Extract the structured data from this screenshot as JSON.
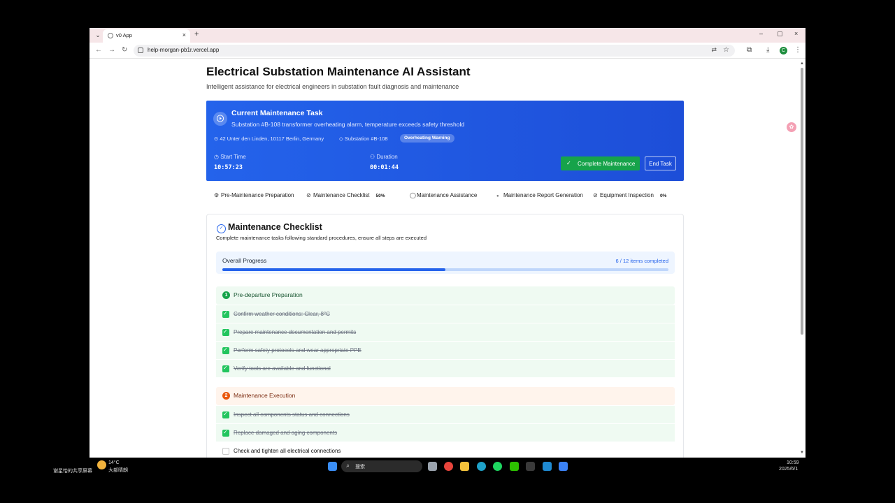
{
  "browser": {
    "tab_title": "v0 App",
    "url": "help-morgan-pb1r.vercel.app",
    "new_tab_symbol": "+",
    "close_symbol": "×",
    "window_controls": [
      "–",
      "▢",
      "×"
    ],
    "profile_initial": "C"
  },
  "page": {
    "title": "Electrical Substation Maintenance AI Assistant",
    "subtitle": "Intelligent assistance for electrical engineers in substation fault diagnosis and maintenance"
  },
  "task": {
    "heading": "Current Maintenance Task",
    "description": "Substation #B-108 transformer overheating alarm, temperature exceeds safety threshold",
    "location": "42 Unter den Linden, 10117 Berlin, Germany",
    "substation": "Substation #B-108",
    "badge": "Overheating Warning",
    "start_time_label": "Start Time",
    "start_time": "10:57:23",
    "duration_label": "Duration",
    "duration": "00:01:44",
    "complete_button": "Complete Maintenance",
    "end_button": "End Task"
  },
  "tabs": [
    {
      "label": "Pre-Maintenance Preparation",
      "icon": "gear-icon"
    },
    {
      "label": "Maintenance Checklist",
      "icon": "check-circle-icon",
      "percent": "50%"
    },
    {
      "label": "Maintenance Assistance",
      "icon": "chat-icon"
    },
    {
      "label": "Maintenance Report Generation",
      "icon": "dot-icon"
    },
    {
      "label": "Equipment Inspection",
      "icon": "check-circle-icon",
      "percent": "0%"
    }
  ],
  "checklist": {
    "title": "Maintenance Checklist",
    "description": "Complete maintenance tasks following standard procedures, ensure all steps are executed",
    "progress_label": "Overall Progress",
    "progress_count": "6 / 12 items completed",
    "progress_fraction": 0.5,
    "sections": [
      {
        "number": "1",
        "title": "Pre-departure Preparation",
        "color": "#16a34a",
        "items": [
          {
            "text": "Confirm weather conditions: Clear, 8°C",
            "done": true
          },
          {
            "text": "Prepare maintenance documentation and permits",
            "done": true
          },
          {
            "text": "Perform safety protocols and wear appropriate PPE",
            "done": true
          },
          {
            "text": "Verify tools are available and functional",
            "done": true
          }
        ]
      },
      {
        "number": "2",
        "title": "Maintenance Execution",
        "color": "#ea580c",
        "items": [
          {
            "text": "Inspect all components status and connections",
            "done": true
          },
          {
            "text": "Replace damaged and aging components",
            "done": true
          },
          {
            "text": "Check and tighten all electrical connections",
            "done": false
          }
        ]
      }
    ]
  },
  "taskbar": {
    "share_text": "谢星怡的共享屏幕",
    "weather_temp": "14°C",
    "weather_desc": "大部晴朗",
    "search_placeholder": "搜索",
    "time": "10:59",
    "date": "2025/6/1"
  },
  "colors": {
    "accent": "#2563eb",
    "success": "#16a34a",
    "warning": "#ea580c"
  }
}
